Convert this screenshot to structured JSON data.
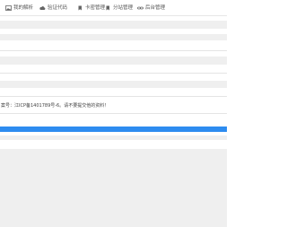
{
  "nav": {
    "items": [
      {
        "label": "我的解析",
        "icon": "image-icon"
      },
      {
        "label": "验证代码",
        "icon": "cloud-icon"
      },
      {
        "label": "卡密管理",
        "icon": "bookmark-icon"
      },
      {
        "label": "分站管理",
        "icon": "bookmark-icon"
      },
      {
        "label": "后台管理",
        "icon": "link-icon"
      }
    ]
  },
  "notice": {
    "text": "案号：江ICP备1401789号-6。请不要提交他的资料！"
  },
  "colors": {
    "accent": "#2d8cf0",
    "band": "#efefef",
    "nav_text": "#555555"
  }
}
